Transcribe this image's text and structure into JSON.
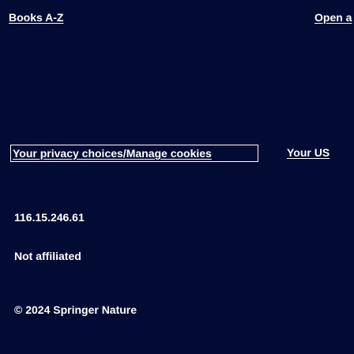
{
  "footer": {
    "books_link": "Books A-Z",
    "open_access_link": "Open a",
    "privacy_link": "Your privacy choices/Manage cookies",
    "your_us_link": "Your US",
    "ip_address": "116.15.246.61",
    "affiliation": "Not affiliated",
    "copyright": "© 2024 Springer Nature"
  },
  "colors": {
    "background": "#010b33",
    "text": "#ffffff"
  }
}
